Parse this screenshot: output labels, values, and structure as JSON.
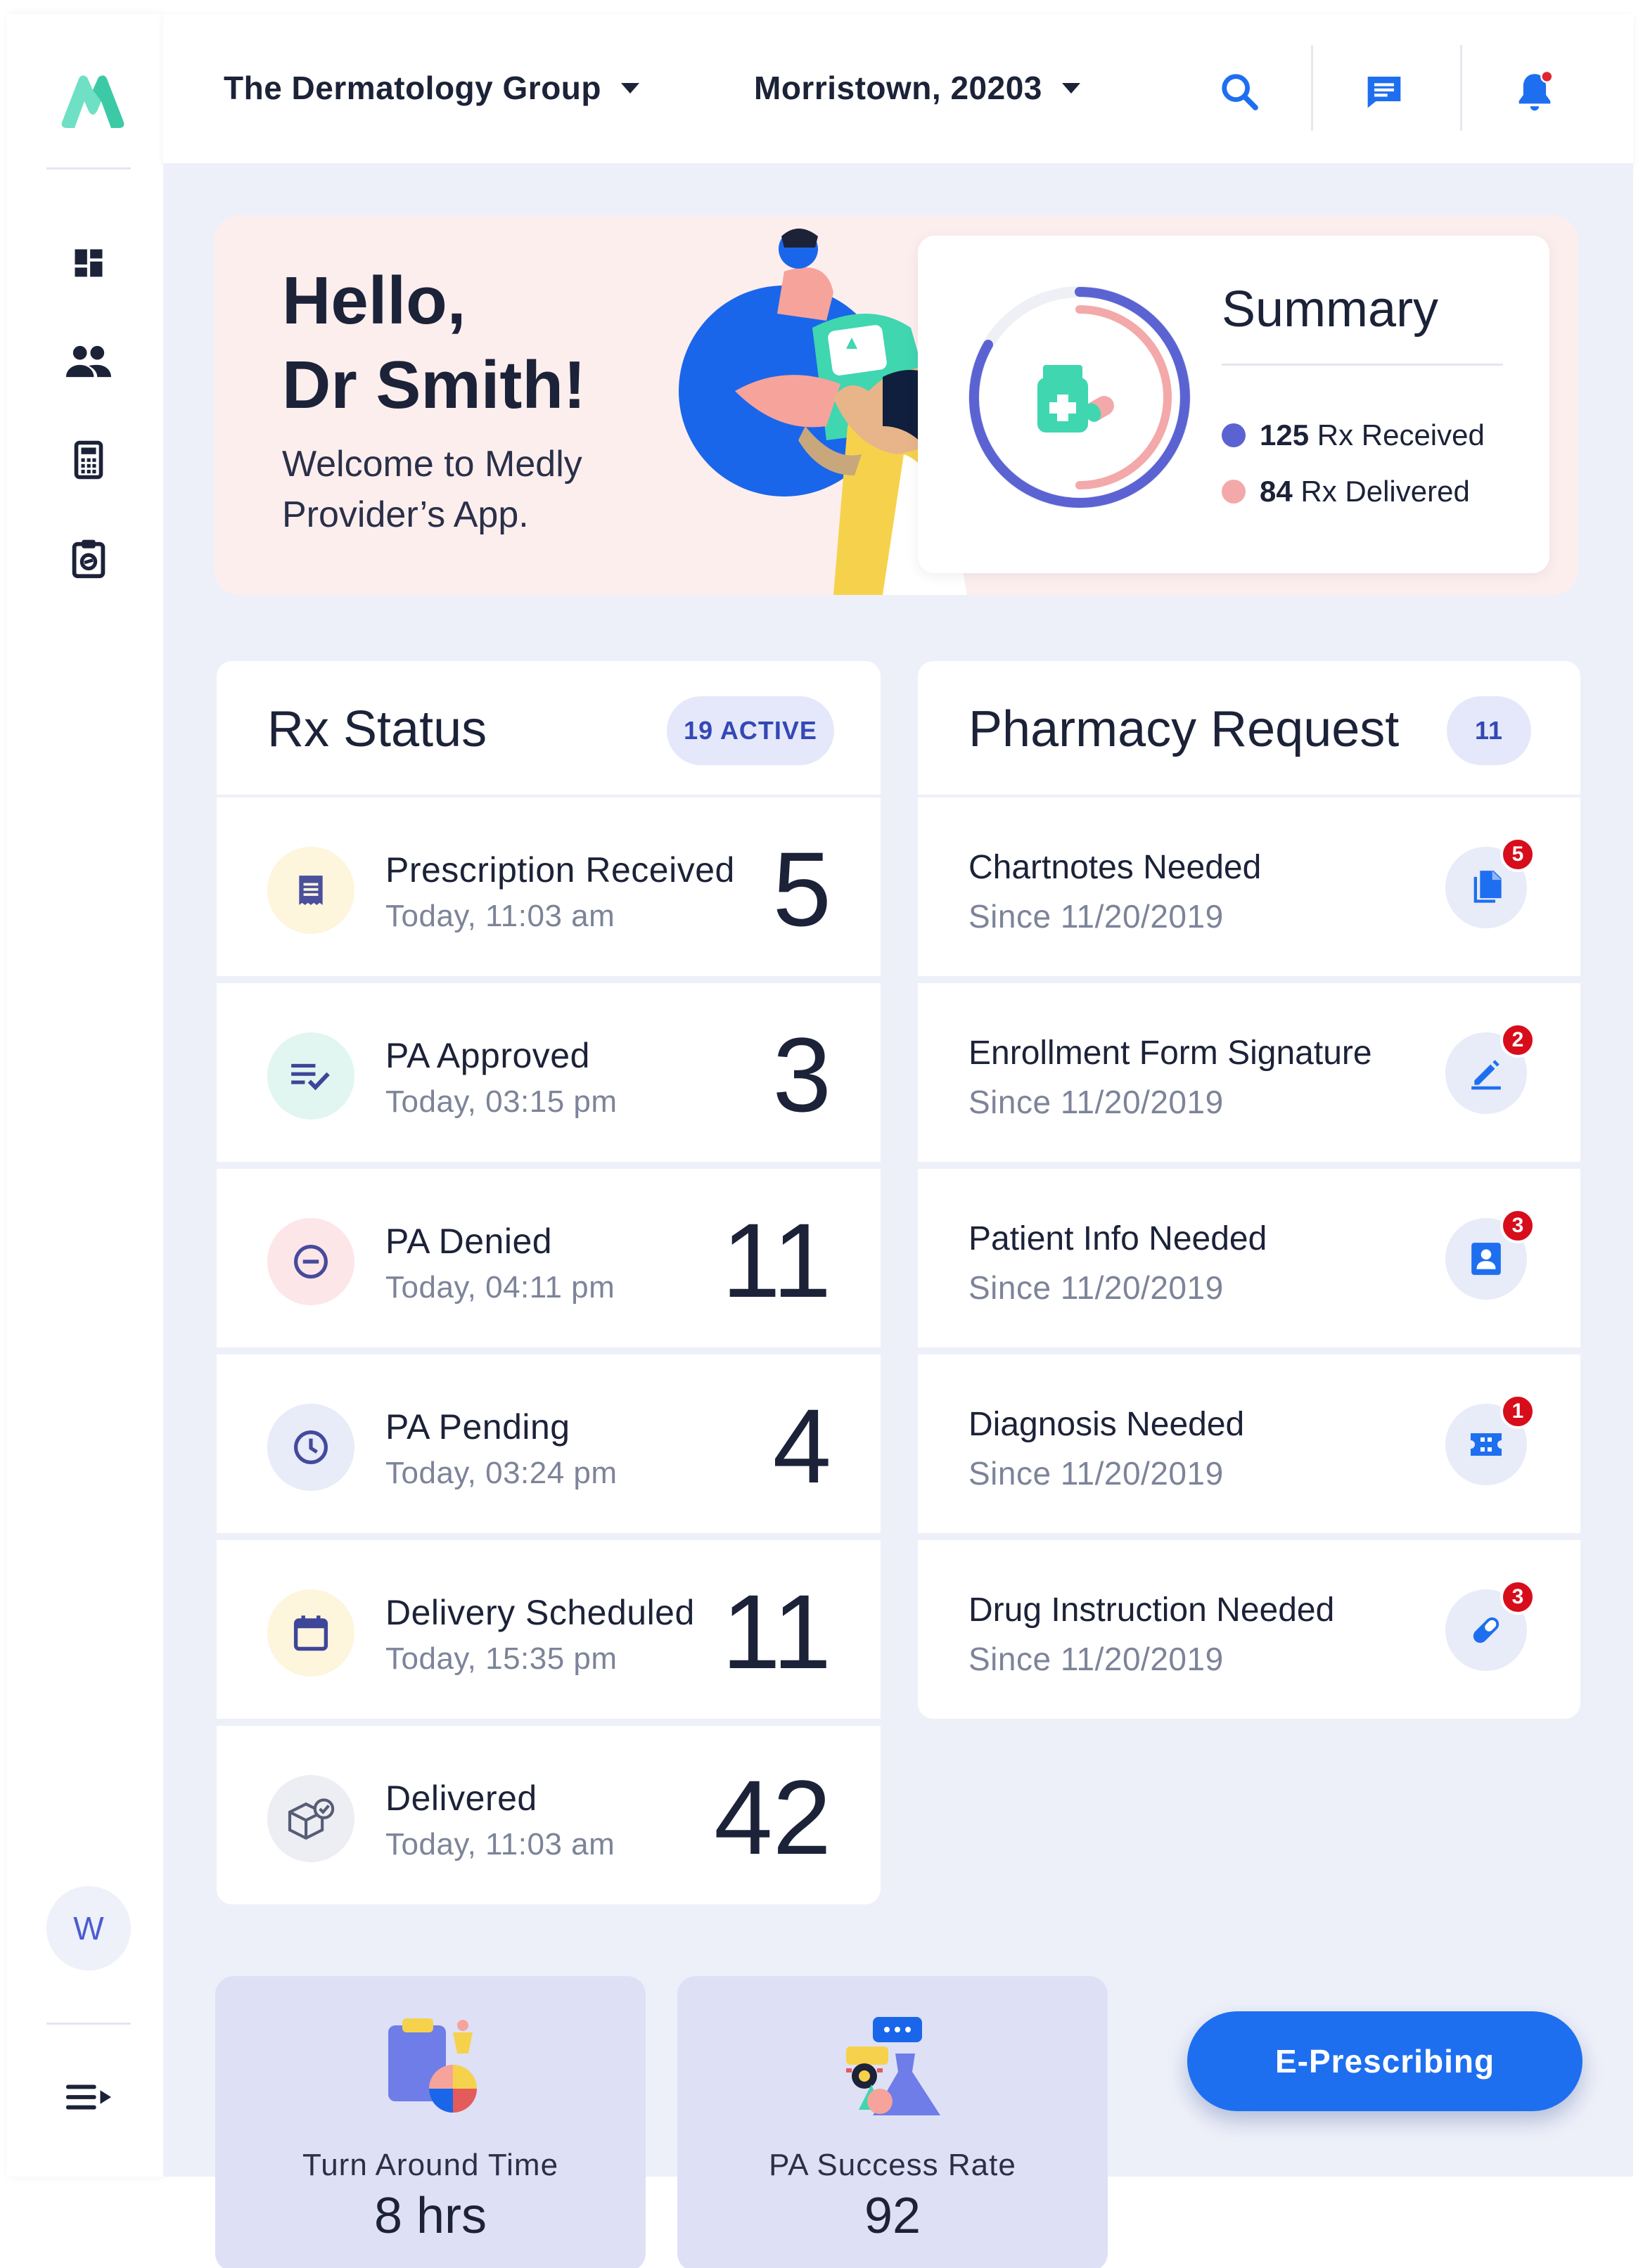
{
  "header": {
    "organization": "The Dermatology Group",
    "location": "Morristown, 20203",
    "icons": [
      "search-icon",
      "chat-icon",
      "bell-icon"
    ]
  },
  "sidebar": {
    "items": [
      {
        "name": "dashboard",
        "icon": "dashboard-icon"
      },
      {
        "name": "patients",
        "icon": "people-icon"
      },
      {
        "name": "calculator",
        "icon": "calculator-icon"
      },
      {
        "name": "clipboard",
        "icon": "clipboard-icon"
      }
    ],
    "avatar_initial": "W"
  },
  "hero": {
    "greeting_line1": "Hello,",
    "greeting_line2": "Dr Smith!",
    "welcome": "Welcome to Medly Provider’s App."
  },
  "summary": {
    "title": "Summary",
    "received_value": "125",
    "received_label": "Rx Received",
    "delivered_value": "84",
    "delivered_label": "Rx Delivered",
    "received_color": "#5b63d3",
    "delivered_color": "#f3a9a9"
  },
  "rx_status": {
    "title": "Rx Status",
    "badge": "19 ACTIVE",
    "items": [
      {
        "label": "Prescription Received",
        "time": "Today, 11:03 am",
        "count": "5",
        "icon": "receipt-icon",
        "bg": "#fdf5dc",
        "fg": "#4b4f9c"
      },
      {
        "label": "PA Approved",
        "time": "Today, 03:15 pm",
        "count": "3",
        "icon": "checklist-icon",
        "bg": "#e1f6f1",
        "fg": "#3e4699"
      },
      {
        "label": "PA Denied",
        "time": "Today, 04:11 pm",
        "count": "11",
        "icon": "minus-circle-icon",
        "bg": "#fde6e8",
        "fg": "#454b9b"
      },
      {
        "label": "PA Pending",
        "time": "Today, 03:24 pm",
        "count": "4",
        "icon": "clock-icon",
        "bg": "#e8ebf8",
        "fg": "#434a9b"
      },
      {
        "label": "Delivery Scheduled",
        "time": "Today, 15:35 pm",
        "count": "11",
        "icon": "calendar-icon",
        "bg": "#fdf5dc",
        "fg": "#3e4699"
      },
      {
        "label": "Delivered",
        "time": "Today, 11:03 am",
        "count": "42",
        "icon": "package-check-icon",
        "bg": "#eceef3",
        "fg": "#565c76"
      }
    ]
  },
  "pharmacy_request": {
    "title": "Pharmacy Request",
    "badge": "11",
    "items": [
      {
        "label": "Chartnotes Needed",
        "since": "Since 11/20/2019",
        "count": "5",
        "icon": "documents-icon"
      },
      {
        "label": "Enrollment Form Signature",
        "since": "Since 11/20/2019",
        "count": "2",
        "icon": "pen-icon"
      },
      {
        "label": "Patient Info Needed",
        "since": "Since 11/20/2019",
        "count": "3",
        "icon": "contact-card-icon"
      },
      {
        "label": "Diagnosis Needed",
        "since": "Since 11/20/2019",
        "count": "1",
        "icon": "ticket-icon"
      },
      {
        "label": "Drug Instruction Needed",
        "since": "Since 11/20/2019",
        "count": "3",
        "icon": "pill-icon"
      }
    ]
  },
  "stats": [
    {
      "label": "Turn Around Time",
      "value": "8 hrs",
      "icon": "clipboard-flask-illustration"
    },
    {
      "label": "PA Success Rate",
      "value": "92",
      "icon": "chat-flask-illustration"
    }
  ],
  "cta": {
    "label": "E-Prescribing"
  },
  "colors": {
    "accent": "#1e6ff0",
    "badge_red": "#d70d1c",
    "navy": "#1c2238"
  }
}
